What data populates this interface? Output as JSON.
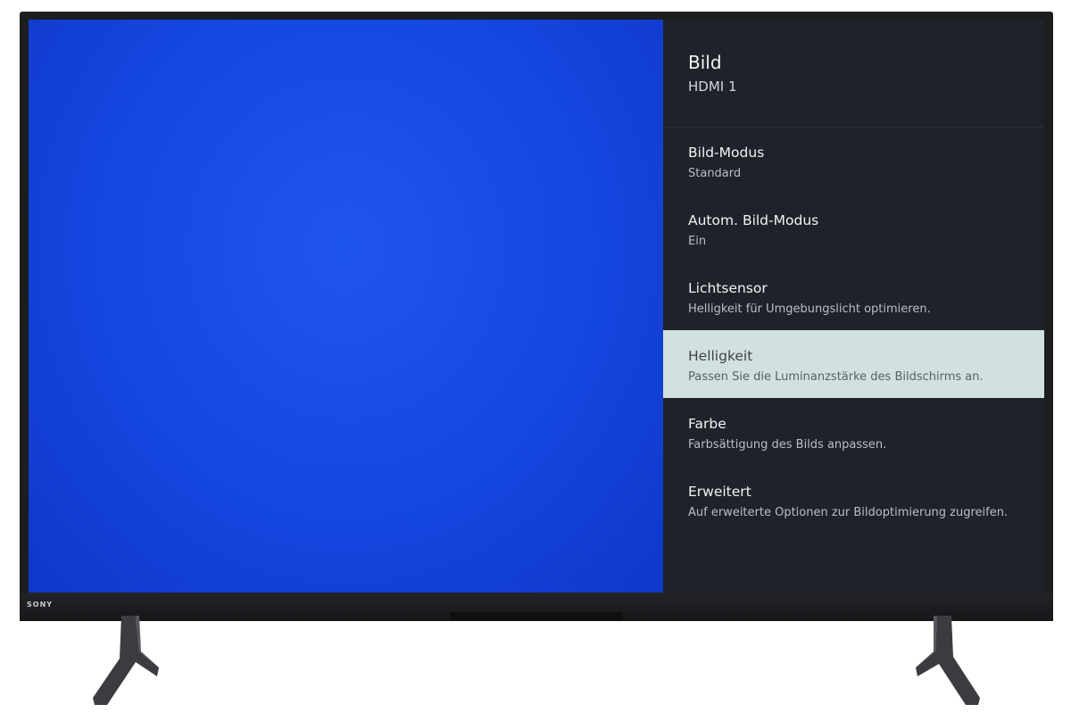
{
  "brand": {
    "logo_text": "SONY"
  },
  "panel": {
    "title": "Bild",
    "subtitle": "HDMI 1",
    "items": [
      {
        "label": "Bild-Modus",
        "desc": "Standard",
        "focused": false
      },
      {
        "label": "Autom. Bild-Modus",
        "desc": "Ein",
        "focused": false
      },
      {
        "label": "Lichtsensor",
        "desc": "Helligkeit für Umgebungslicht optimieren.",
        "focused": false
      },
      {
        "label": "Helligkeit",
        "desc": "Passen Sie die Luminanzstärke des Bildschirms an.",
        "focused": true
      },
      {
        "label": "Farbe",
        "desc": "Farbsättigung des Bilds anpassen.",
        "focused": false
      },
      {
        "label": "Erweitert",
        "desc": "Auf erweiterte Optionen zur Bildoptimierung zugreifen.",
        "focused": false
      }
    ]
  },
  "colors": {
    "screen_blue": "#1546e0",
    "panel_bg": "#1e232a",
    "focus_bg": "#d2e0e0",
    "bezel": "#1b1d1f"
  }
}
